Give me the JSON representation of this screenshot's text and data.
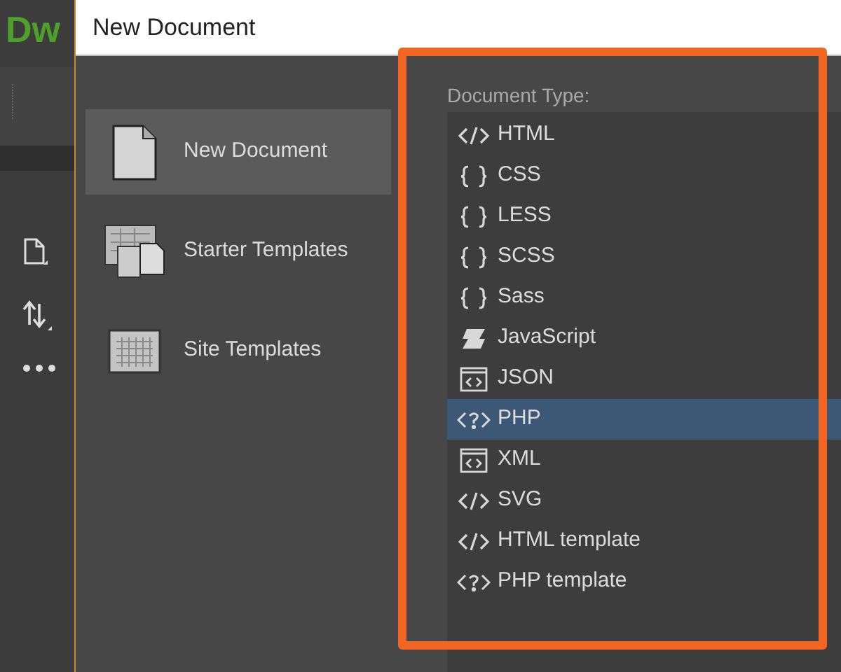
{
  "app": {
    "logo": "Dw"
  },
  "window": {
    "title": "New Document"
  },
  "categories": [
    {
      "label": "New Document",
      "kind": "page",
      "selected": true
    },
    {
      "label": "Starter Templates",
      "kind": "starter",
      "selected": false
    },
    {
      "label": "Site Templates",
      "kind": "site",
      "selected": false
    }
  ],
  "document_type": {
    "label": "Document Type:",
    "items": [
      {
        "label": "HTML",
        "kind": "tag",
        "selected": false
      },
      {
        "label": "CSS",
        "kind": "braces",
        "selected": false
      },
      {
        "label": "LESS",
        "kind": "braces",
        "selected": false
      },
      {
        "label": "SCSS",
        "kind": "braces",
        "selected": false
      },
      {
        "label": "Sass",
        "kind": "braces",
        "selected": false
      },
      {
        "label": "JavaScript",
        "kind": "script",
        "selected": false
      },
      {
        "label": "JSON",
        "kind": "file",
        "selected": false
      },
      {
        "label": "PHP",
        "kind": "php",
        "selected": true
      },
      {
        "label": "XML",
        "kind": "file",
        "selected": false
      },
      {
        "label": "SVG",
        "kind": "tag",
        "selected": false
      },
      {
        "label": "HTML template",
        "kind": "tag",
        "selected": false
      },
      {
        "label": "PHP template",
        "kind": "php",
        "selected": false
      }
    ]
  }
}
